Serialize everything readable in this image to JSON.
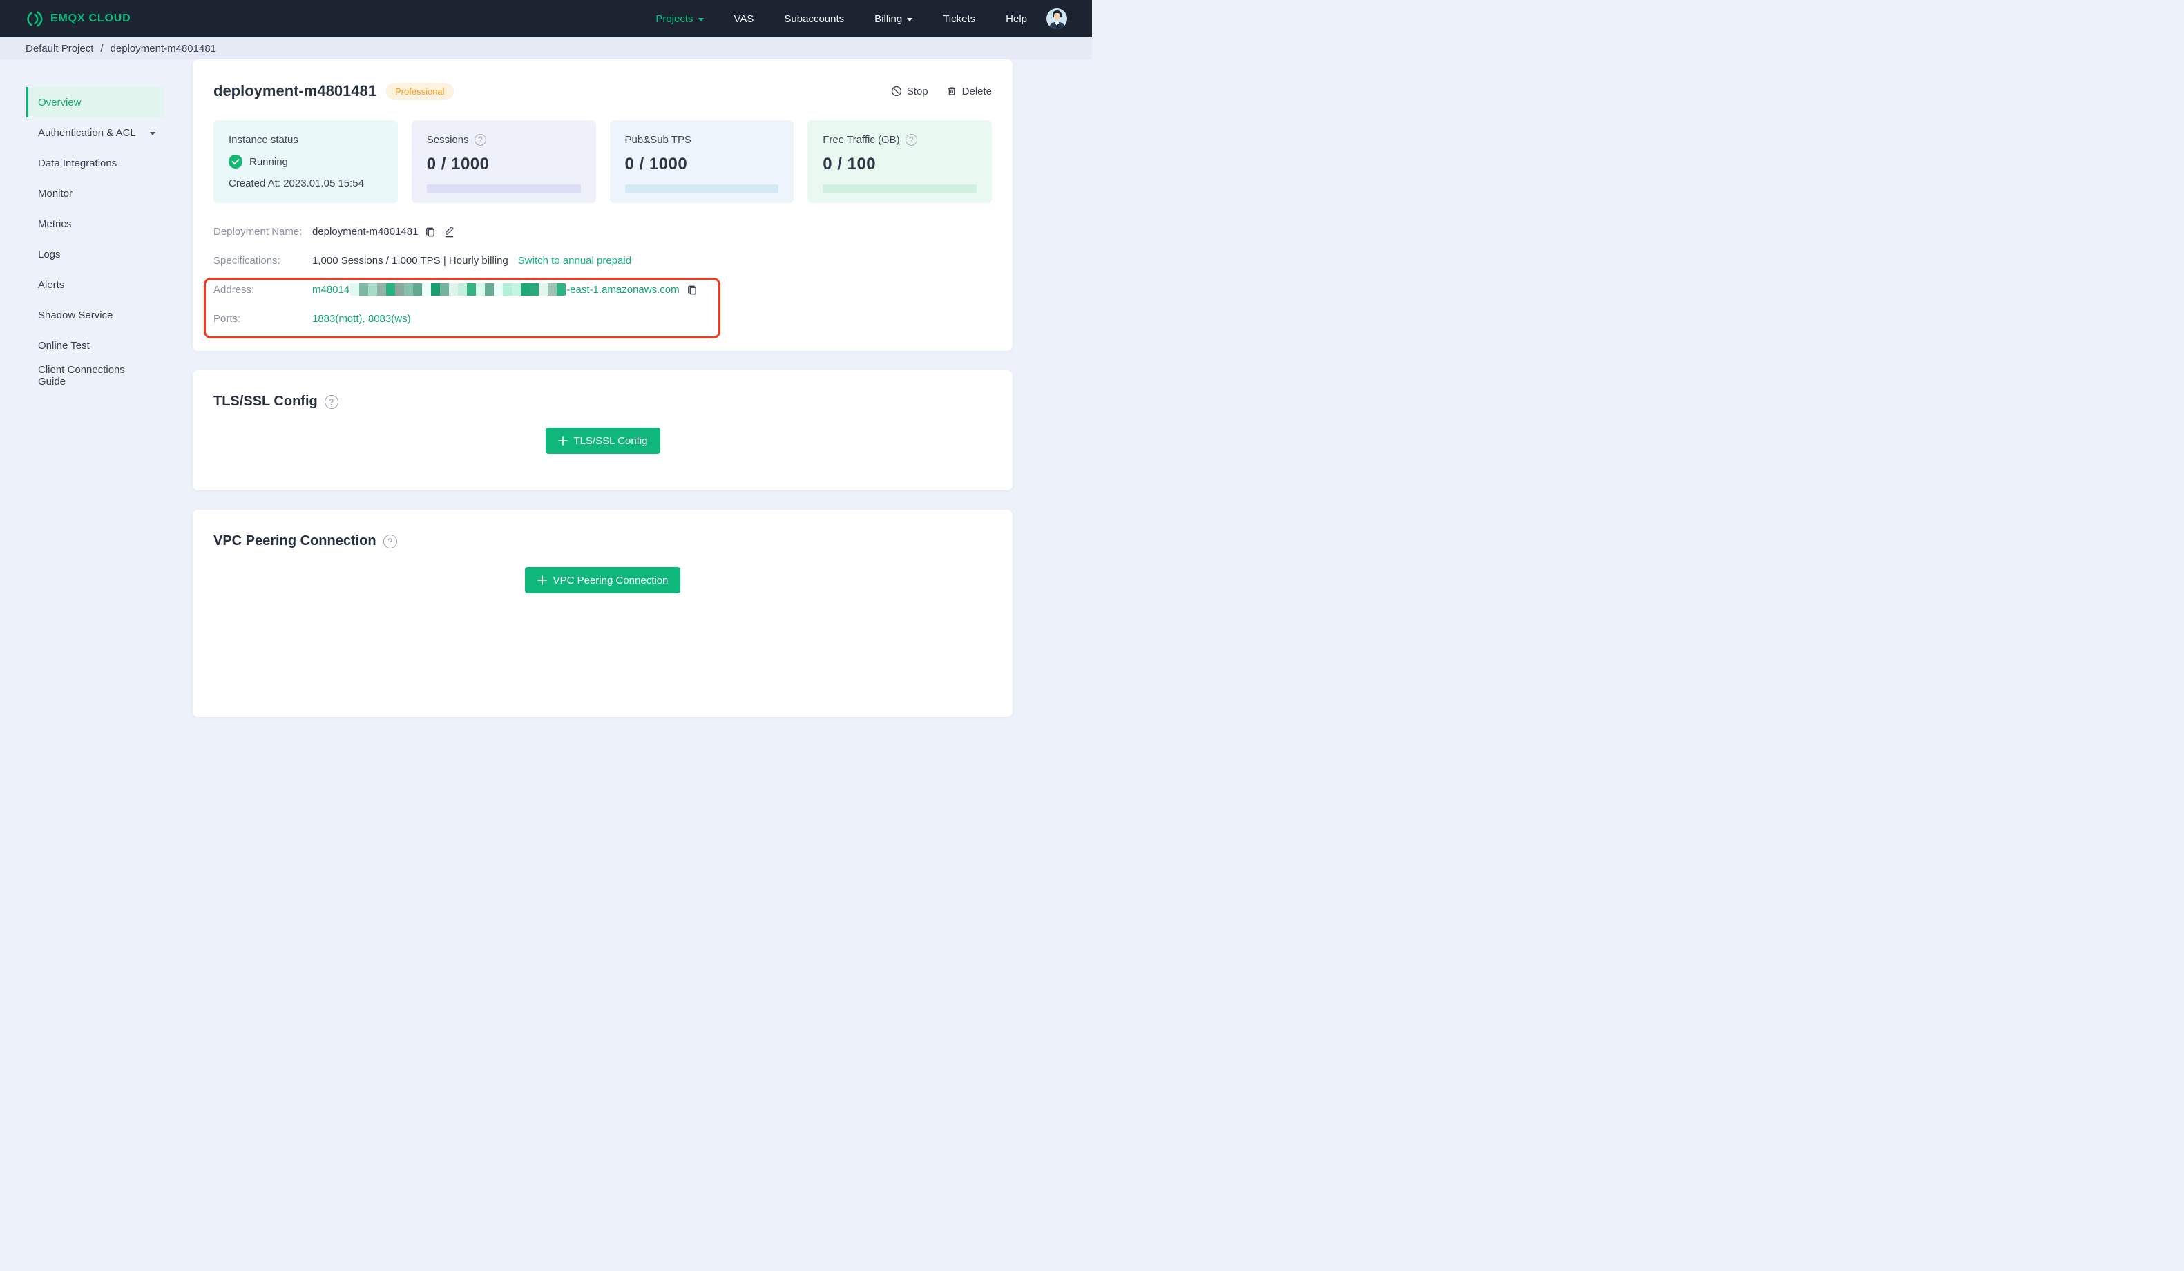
{
  "brand": {
    "name": "EMQX CLOUD"
  },
  "nav": {
    "items": [
      {
        "label": "Projects"
      },
      {
        "label": "VAS"
      },
      {
        "label": "Subaccounts"
      },
      {
        "label": "Billing"
      },
      {
        "label": "Tickets"
      },
      {
        "label": "Help"
      }
    ]
  },
  "breadcrumb": {
    "project": "Default Project",
    "separator": "/",
    "current": "deployment-m4801481"
  },
  "sidebar": {
    "items": [
      {
        "label": "Overview"
      },
      {
        "label": "Authentication & ACL"
      },
      {
        "label": "Data Integrations"
      },
      {
        "label": "Monitor"
      },
      {
        "label": "Metrics"
      },
      {
        "label": "Logs"
      },
      {
        "label": "Alerts"
      },
      {
        "label": "Shadow Service"
      },
      {
        "label": "Online Test"
      },
      {
        "label": "Client Connections Guide"
      }
    ]
  },
  "deployment": {
    "title": "deployment-m4801481",
    "plan": "Professional",
    "stop_label": "Stop",
    "delete_label": "Delete",
    "stats": {
      "instance": {
        "label": "Instance status",
        "status": "Running",
        "created_at": "Created At: 2023.01.05 15:54",
        "bg": "#ebf8f9"
      },
      "sessions": {
        "label": "Sessions",
        "value": "0 / 1000",
        "bg": "#eef0fa",
        "bar": "#dbdef6"
      },
      "tps": {
        "label": "Pub&Sub TPS",
        "value": "0 / 1000",
        "bg": "#edf4fb",
        "bar": "#d4e9f6"
      },
      "traffic": {
        "label": "Free Traffic (GB)",
        "value": "0 / 100",
        "bg": "#e9f9f2",
        "bar": "#d2f0e0"
      }
    },
    "info": {
      "name_label": "Deployment Name:",
      "name_value": "deployment-m4801481",
      "spec_label": "Specifications:",
      "spec_value": "1,000 Sessions / 1,000 TPS | Hourly billing",
      "spec_link": "Switch to annual prepaid",
      "address_label": "Address:",
      "address_prefix": "m48014",
      "address_suffix": "-east-1.amazonaws.com",
      "address_mosaic": [
        "#dffaf0",
        "#7db8a4",
        "#a8dcc6",
        "#8fb3a6",
        "#27b27e",
        "#8aa89c",
        "#84c0ab",
        "#62a890",
        "#eafffa",
        "#1d9e71",
        "#74b3a0",
        "#ddf5ea",
        "#c2f0dd",
        "#35b381",
        "#d9fcee",
        "#67ab93",
        "#e8fffa",
        "#b3f0d8",
        "#c4f5e2",
        "#1fa877",
        "#2aa97b",
        "#e2f8ee",
        "#9dc2b2",
        "#2db381"
      ],
      "ports_label": "Ports:",
      "ports_value": "1883(mqtt), 8083(ws)"
    },
    "annotation_color": "#f4391d"
  },
  "sections": {
    "tls": {
      "title": "TLS/SSL Config",
      "button": "TLS/SSL Config"
    },
    "vpc": {
      "title": "VPC Peering Connection",
      "button": "VPC Peering Connection"
    }
  },
  "icons": {
    "help": "?"
  },
  "colors": {
    "nav_bg": "#1c2432",
    "accent_green": "#0fb87a",
    "link_green": "#16a873",
    "sidebar_active_green": "#0bb470",
    "badge_text": "#f99b23",
    "badge_bg": "#fdf2de",
    "annotation_red": "#f4391d"
  }
}
